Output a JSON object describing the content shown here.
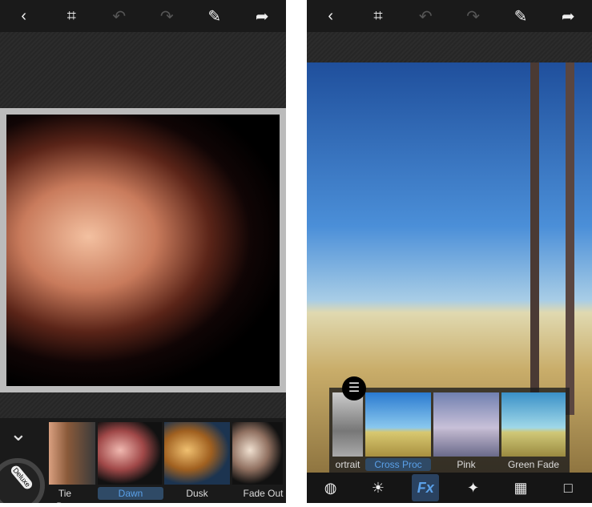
{
  "left_screen": {
    "topbar": {
      "back": "‹",
      "crop": "⌗",
      "undo": "↶",
      "redo": "↷",
      "brush": "✎",
      "share": "➦"
    },
    "collapse": "⌄",
    "badge": "Deluxe",
    "filters": [
      {
        "label": "Tie Dye"
      },
      {
        "label": "Dawn",
        "selected": true
      },
      {
        "label": "Dusk"
      },
      {
        "label": "Fade Out"
      }
    ]
  },
  "right_screen": {
    "topbar": {
      "back": "‹",
      "crop": "⌗",
      "undo": "↶",
      "redo": "↷",
      "brush": "✎",
      "share": "➦"
    },
    "adjust": "☰",
    "filters": [
      {
        "label": "ortrait"
      },
      {
        "label": "Cross Proc",
        "selected": true
      },
      {
        "label": "Pink"
      },
      {
        "label": "Green Fade"
      }
    ],
    "tools": {
      "globe": "◍",
      "brightness": "☀",
      "fx": "Fx",
      "stars": "✦",
      "checker": "▦",
      "frame": "□"
    }
  },
  "colors": {
    "accent": "#5aa0e8",
    "selected_bg": "#2f4a66"
  }
}
